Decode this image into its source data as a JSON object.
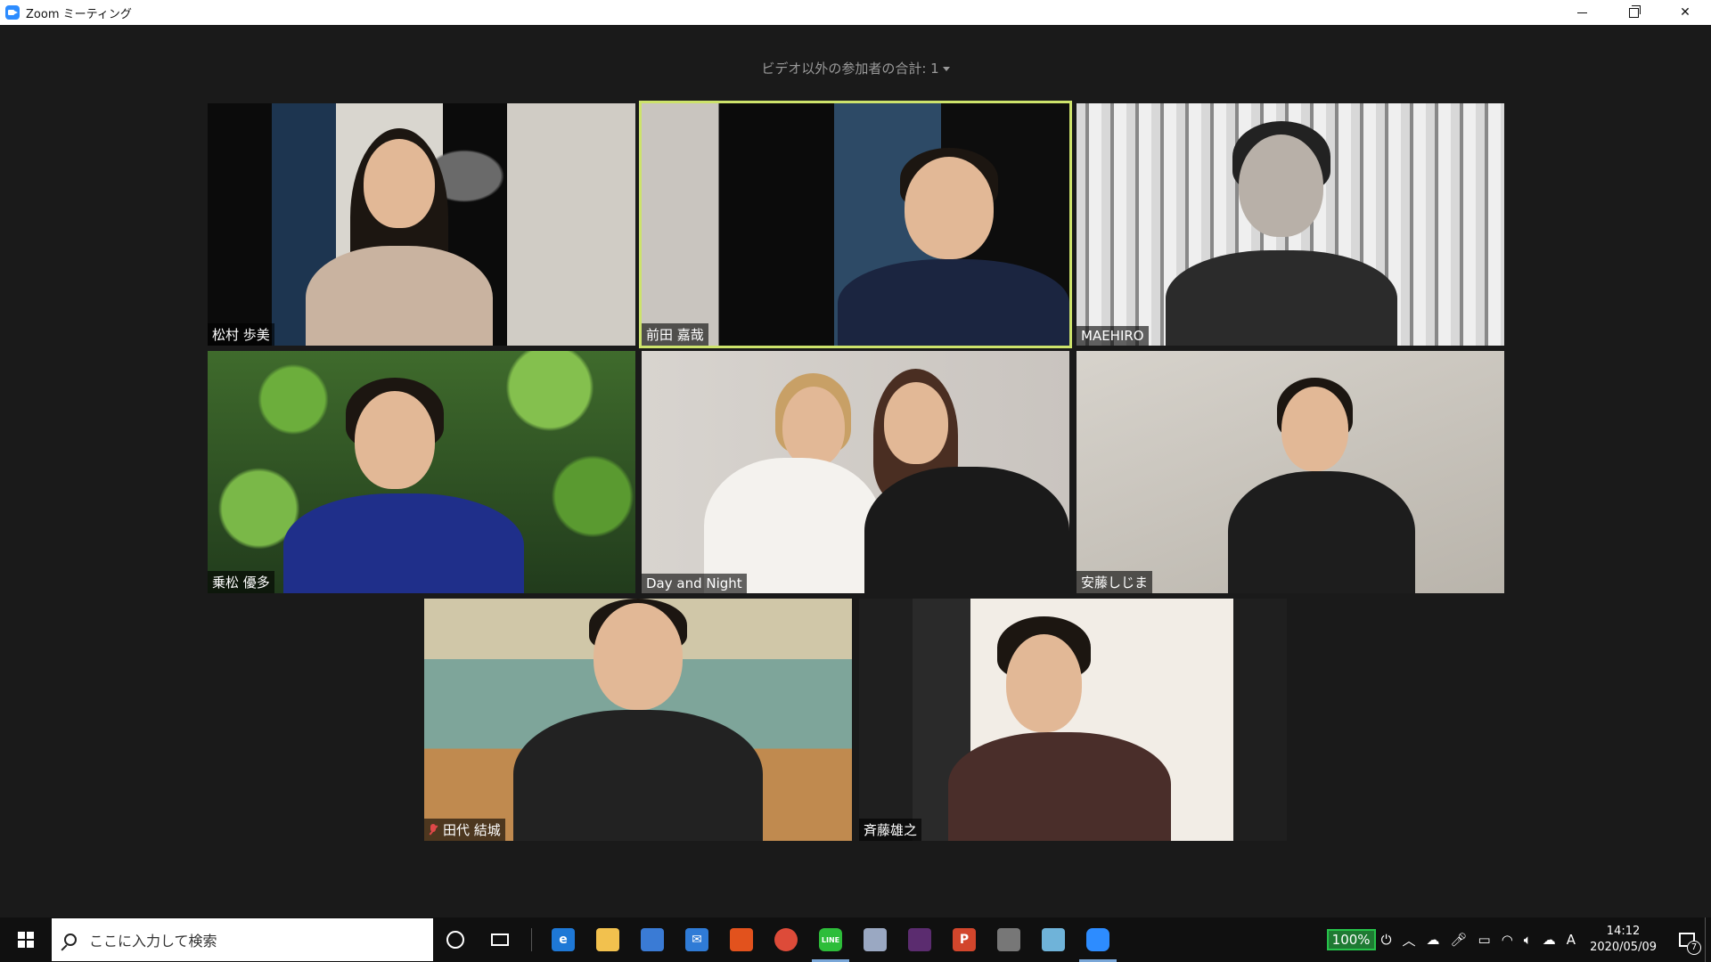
{
  "window": {
    "title": "Zoom ミーティング",
    "controls": [
      "minimize",
      "restore",
      "close"
    ]
  },
  "meeting": {
    "non_video_count_label": "ビデオ以外の参加者の合計: 1",
    "participants": [
      {
        "name": "松村 歩美",
        "active": false,
        "muted": false
      },
      {
        "name": "前田 嘉哉",
        "active": true,
        "muted": false
      },
      {
        "name": "MAEHIRO",
        "active": false,
        "muted": false
      },
      {
        "name": "乗松 優多",
        "active": false,
        "muted": false
      },
      {
        "name": "Day and Night",
        "active": false,
        "muted": false
      },
      {
        "name": "安藤しじま",
        "active": false,
        "muted": false
      },
      {
        "name": "田代 結城",
        "active": false,
        "muted": true
      },
      {
        "name": "斉藤雄之",
        "active": false,
        "muted": false
      }
    ],
    "active_speaker_color": "#cde36b"
  },
  "taskbar": {
    "search_placeholder": "ここに入力して検索",
    "pinned_apps": [
      {
        "icon": "edge-icon",
        "color": "#1e78d6",
        "glyph": "e"
      },
      {
        "icon": "file-explorer-icon",
        "color": "#f2c14e",
        "glyph": ""
      },
      {
        "icon": "store-icon",
        "color": "#3a7bd5",
        "glyph": ""
      },
      {
        "icon": "mail-icon",
        "color": "#2f7bd6",
        "glyph": "✉"
      },
      {
        "icon": "office-icon",
        "color": "#e2521d",
        "glyph": ""
      },
      {
        "icon": "chrome-icon",
        "color": "#dd4b39",
        "glyph": ""
      },
      {
        "icon": "line-icon",
        "color": "#2dbd3a",
        "glyph": "LINE"
      },
      {
        "icon": "app-icon",
        "color": "#9aa8c2",
        "glyph": ""
      },
      {
        "icon": "slack-icon",
        "color": "#5b2c6f",
        "glyph": ""
      },
      {
        "icon": "powerpoint-icon",
        "color": "#d2462c",
        "glyph": "P"
      },
      {
        "icon": "disc-icon",
        "color": "#777777",
        "glyph": ""
      },
      {
        "icon": "notes-icon",
        "color": "#6fb3d9",
        "glyph": ""
      },
      {
        "icon": "zoom-icon",
        "color": "#2d8cff",
        "glyph": ""
      }
    ],
    "battery_label": "100%",
    "ime_label": "A",
    "clock": {
      "time": "14:12",
      "date": "2020/05/09"
    },
    "notification_count": "7"
  }
}
